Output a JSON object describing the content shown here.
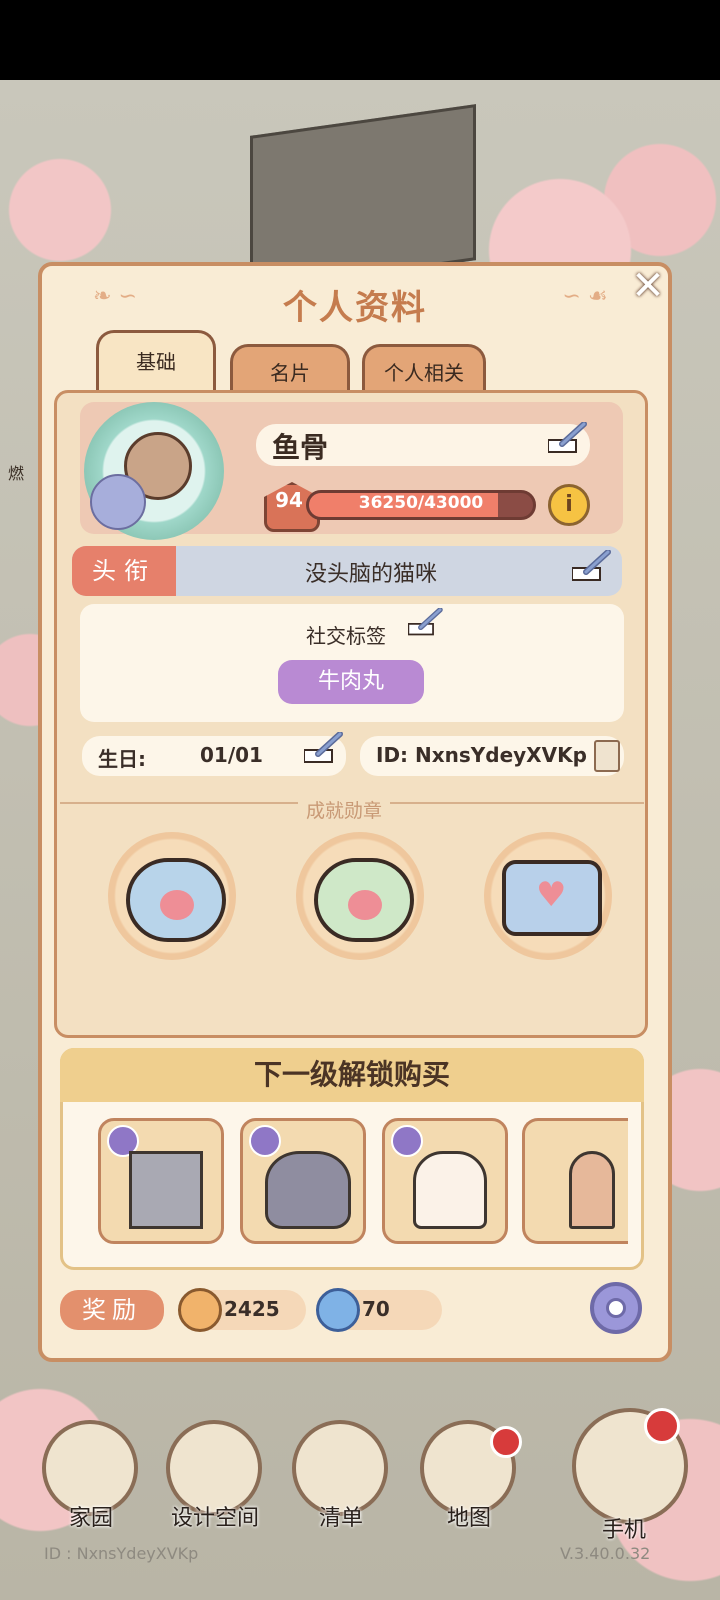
{
  "panel": {
    "title": "个人资料",
    "close": "✕"
  },
  "tabs": [
    {
      "label": "基础",
      "active": true
    },
    {
      "label": "名片",
      "active": false
    },
    {
      "label": "个人相关",
      "active": false
    }
  ],
  "profile": {
    "name": "鱼骨",
    "level": "94",
    "xp_text": "36250/43000",
    "xp_fraction": 0.843,
    "info": "i"
  },
  "title_row": {
    "label": "头衔",
    "value": "没头脑的猫咪"
  },
  "social": {
    "label": "社交标签",
    "tag": "牛肉丸"
  },
  "birthday": {
    "label": "生日:",
    "value": "01/01"
  },
  "user_id": "ID: NxnsYdeyXVKp",
  "achievements": {
    "title": "成就勋章"
  },
  "unlock": {
    "title": "下一级解锁购买"
  },
  "reward": {
    "label": "奖励",
    "coins": "2425",
    "gems": "70"
  },
  "background": {
    "left_label": "燃"
  },
  "nav": [
    {
      "label": "家园"
    },
    {
      "label": "设计空间"
    },
    {
      "label": "清单"
    },
    {
      "label": "地图"
    },
    {
      "label": "手机"
    }
  ],
  "footer": {
    "id": "ID : NxnsYdeyXVKp",
    "version": "V.3.40.0.32"
  }
}
